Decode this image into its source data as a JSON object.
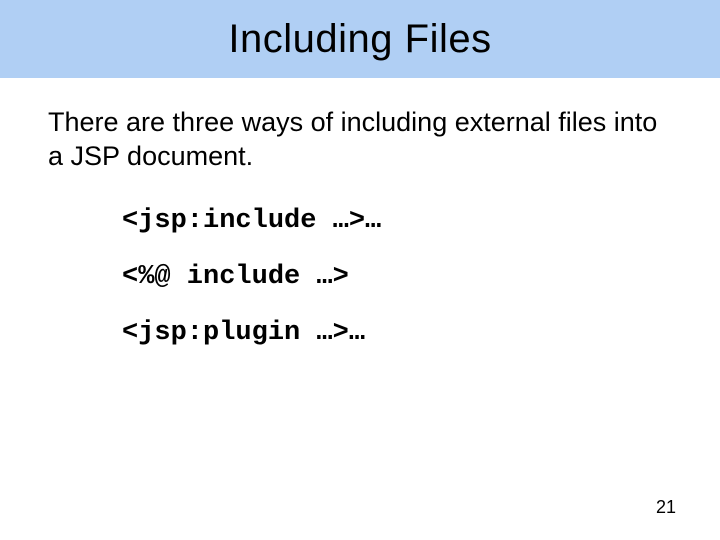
{
  "title": "Including Files",
  "intro": "There are three ways of including external files into a JSP document.",
  "code": {
    "line1": "<jsp:include …>…",
    "line2": "<%@ include …>",
    "line3": "<jsp:plugin …>…"
  },
  "page_number": "21"
}
